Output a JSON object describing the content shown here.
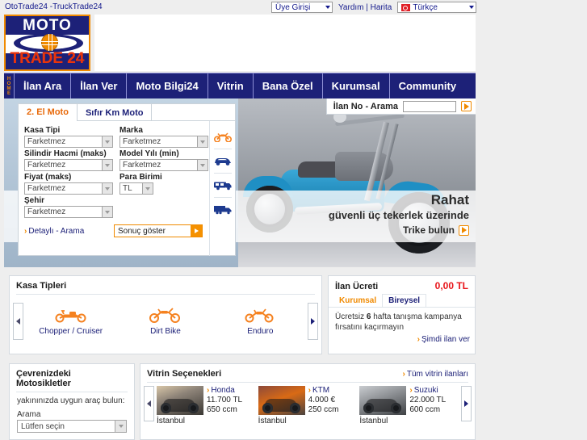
{
  "topbar": {
    "site_links": "OtoTrade24 -TruckTrade24",
    "member_login": "Üye Girişi",
    "help": "Yardım",
    "separator": "|",
    "map": "Harita",
    "language": "Türkçe"
  },
  "logo": {
    "top": "MOTO",
    "bottom": "TRADE 24"
  },
  "nav": {
    "home": "HOME",
    "items": [
      {
        "label": "İlan Ara"
      },
      {
        "label": "İlan Ver"
      },
      {
        "label": "Moto Bilgi24"
      },
      {
        "label": "Vitrin"
      },
      {
        "label": "Bana Özel"
      },
      {
        "label": "Kurumsal"
      },
      {
        "label": "Community"
      }
    ]
  },
  "hero": {
    "ilan_no_label": "İlan No - Arama",
    "ilan_no_value": "",
    "ilan_no_placeholder": "",
    "headline": "Rahat",
    "subline": "güvenli üç tekerlek üzerinde",
    "cta": "Trike bulun"
  },
  "search": {
    "tabs": [
      {
        "label": "2. El Moto",
        "active": true
      },
      {
        "label": "Sıfır Km Moto",
        "active": false
      }
    ],
    "fields": [
      {
        "label": "Kasa Tipi",
        "value": "Farketmez"
      },
      {
        "label": "Marka",
        "value": "Farketmez"
      },
      {
        "label": "Silindir Hacmi (maks)",
        "value": "Farketmez"
      },
      {
        "label": "Model Yılı (min)",
        "value": "Farketmez"
      },
      {
        "label": "Fiyat (maks)",
        "value": "Farketmez"
      },
      {
        "label": "Para Birimi",
        "value": "TL"
      },
      {
        "label": "Şehir",
        "value": "Farketmez"
      }
    ],
    "detailed_link": "Detaylı - Arama",
    "submit": "Sonuç göster",
    "vehicle_icons": [
      "motorcycle-icon",
      "car-icon",
      "van-icon",
      "truck-icon"
    ]
  },
  "kasa": {
    "title": "Kasa Tipleri",
    "items": [
      {
        "label": "Chopper / Cruiser"
      },
      {
        "label": "Dirt Bike"
      },
      {
        "label": "Enduro"
      }
    ]
  },
  "ucret": {
    "title": "İlan Ücreti",
    "price": "0,00 TL",
    "tabs": [
      {
        "label": "Kurumsal",
        "active": true
      },
      {
        "label": "Bireysel",
        "active": false
      }
    ],
    "text_before": "Ücretsiz ",
    "text_bold": "6",
    "text_after": " hafta tanışma kampanya fırsatını kaçırmayın",
    "link": "Şimdi ilan ver"
  },
  "cevre": {
    "title": "Çevrenizdeki Motosikletler",
    "subtitle": "yakınınızda uygun araç bulun:",
    "field_label": "Arama",
    "field_value": "Lütfen seçin"
  },
  "vitrin": {
    "title": "Vitrin Seçenekleri",
    "all_link": "Tüm vitrin ilanları",
    "cards": [
      {
        "brand": "Honda",
        "price": "11.700 TL",
        "engine": "650 ccm",
        "city": "İstanbul"
      },
      {
        "brand": "KTM",
        "price": "4.000 €",
        "engine": "250 ccm",
        "city": "İstanbul"
      },
      {
        "brand": "Suzuki",
        "price": "22.000 TL",
        "engine": "600 ccm",
        "city": "İstanbul"
      }
    ]
  },
  "colors": {
    "brand_navy": "#1d2178",
    "accent_orange": "#f08a00",
    "price_red": "#e8151a",
    "link_blue": "#1d2178",
    "page_bg": "#eeeeee"
  }
}
